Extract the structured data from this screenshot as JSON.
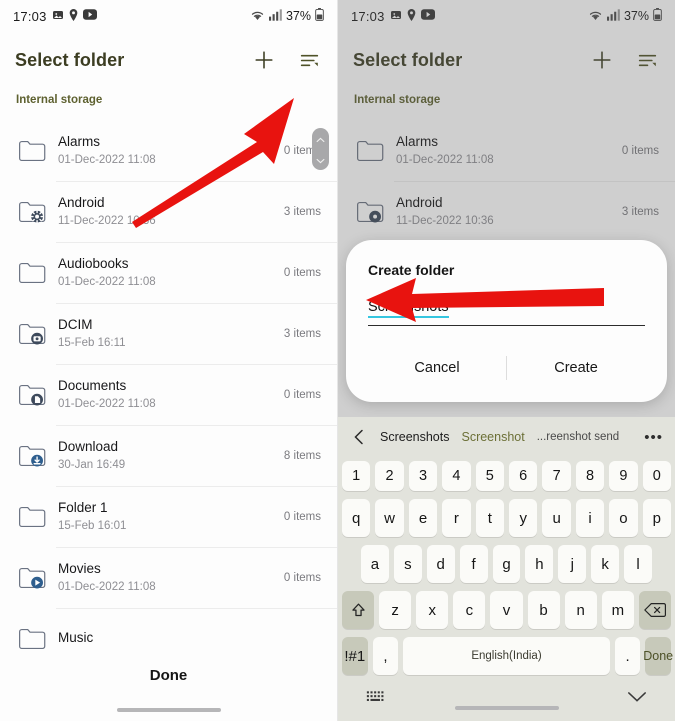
{
  "statusbar": {
    "time": "17:03",
    "battery_percent": "37%",
    "icons": [
      "image-icon",
      "location-pin-icon",
      "youtube-icon",
      "wifi-icon",
      "signal-icon",
      "battery-icon"
    ]
  },
  "header": {
    "title": "Select folder",
    "add_icon": "plus-icon",
    "sort_icon": "sort-icon"
  },
  "breadcrumb": {
    "label": "Internal storage"
  },
  "folders": [
    {
      "name": "Alarms",
      "date": "01-Dec-2022 11:08",
      "count": "0 items",
      "icon": "folder-icon"
    },
    {
      "name": "Android",
      "date": "11-Dec-2022 10:36",
      "count": "3 items",
      "icon": "folder-gear-icon"
    },
    {
      "name": "Audiobooks",
      "date": "01-Dec-2022 11:08",
      "count": "0 items",
      "icon": "folder-icon"
    },
    {
      "name": "DCIM",
      "date": "15-Feb 16:11",
      "count": "3 items",
      "icon": "folder-camera-icon"
    },
    {
      "name": "Documents",
      "date": "01-Dec-2022 11:08",
      "count": "0 items",
      "icon": "folder-document-icon"
    },
    {
      "name": "Download",
      "date": "30-Jan 16:49",
      "count": "8 items",
      "icon": "folder-download-icon"
    },
    {
      "name": "Folder 1",
      "date": "15-Feb 16:01",
      "count": "0 items",
      "icon": "folder-icon"
    },
    {
      "name": "Movies",
      "date": "01-Dec-2022 11:08",
      "count": "0 items",
      "icon": "folder-video-icon"
    },
    {
      "name": "Music",
      "date": "",
      "count": "",
      "icon": "folder-icon"
    }
  ],
  "footer": {
    "done_label": "Done"
  },
  "dialog": {
    "title": "Create folder",
    "input_value": "Screenshots",
    "cancel_label": "Cancel",
    "create_label": "Create"
  },
  "keyboard": {
    "back_icon": "chevron-left-icon",
    "suggestions": [
      "Screenshots",
      "Screenshot",
      "...reenshot send"
    ],
    "more_icon": "overflow-dots-icon",
    "row_numbers": [
      "1",
      "2",
      "3",
      "4",
      "5",
      "6",
      "7",
      "8",
      "9",
      "0"
    ],
    "row_top": [
      "q",
      "w",
      "e",
      "r",
      "t",
      "y",
      "u",
      "i",
      "o",
      "p"
    ],
    "row_mid": [
      "a",
      "s",
      "d",
      "f",
      "g",
      "h",
      "j",
      "k",
      "l"
    ],
    "row_bot": [
      "z",
      "x",
      "c",
      "v",
      "b",
      "n",
      "m"
    ],
    "shift_icon": "shift-icon",
    "backspace_icon": "backspace-icon",
    "symbols_label": "!#1",
    "comma_label": ",",
    "space_label": "English(India)",
    "period_label": ".",
    "done_label": "Done",
    "switch_icon": "keyboard-switch-icon",
    "hide_icon": "chevron-down-icon"
  },
  "annotations": {
    "arrow_left": "red-arrow-pointing-to-add-button",
    "arrow_right": "red-arrow-pointing-to-name-input"
  },
  "colors": {
    "accent_olive": "#5e6130",
    "arrow_red": "#e8130f",
    "spellcheck_cyan": "#35c6e0",
    "keyboard_bg": "#e2e3dc"
  }
}
